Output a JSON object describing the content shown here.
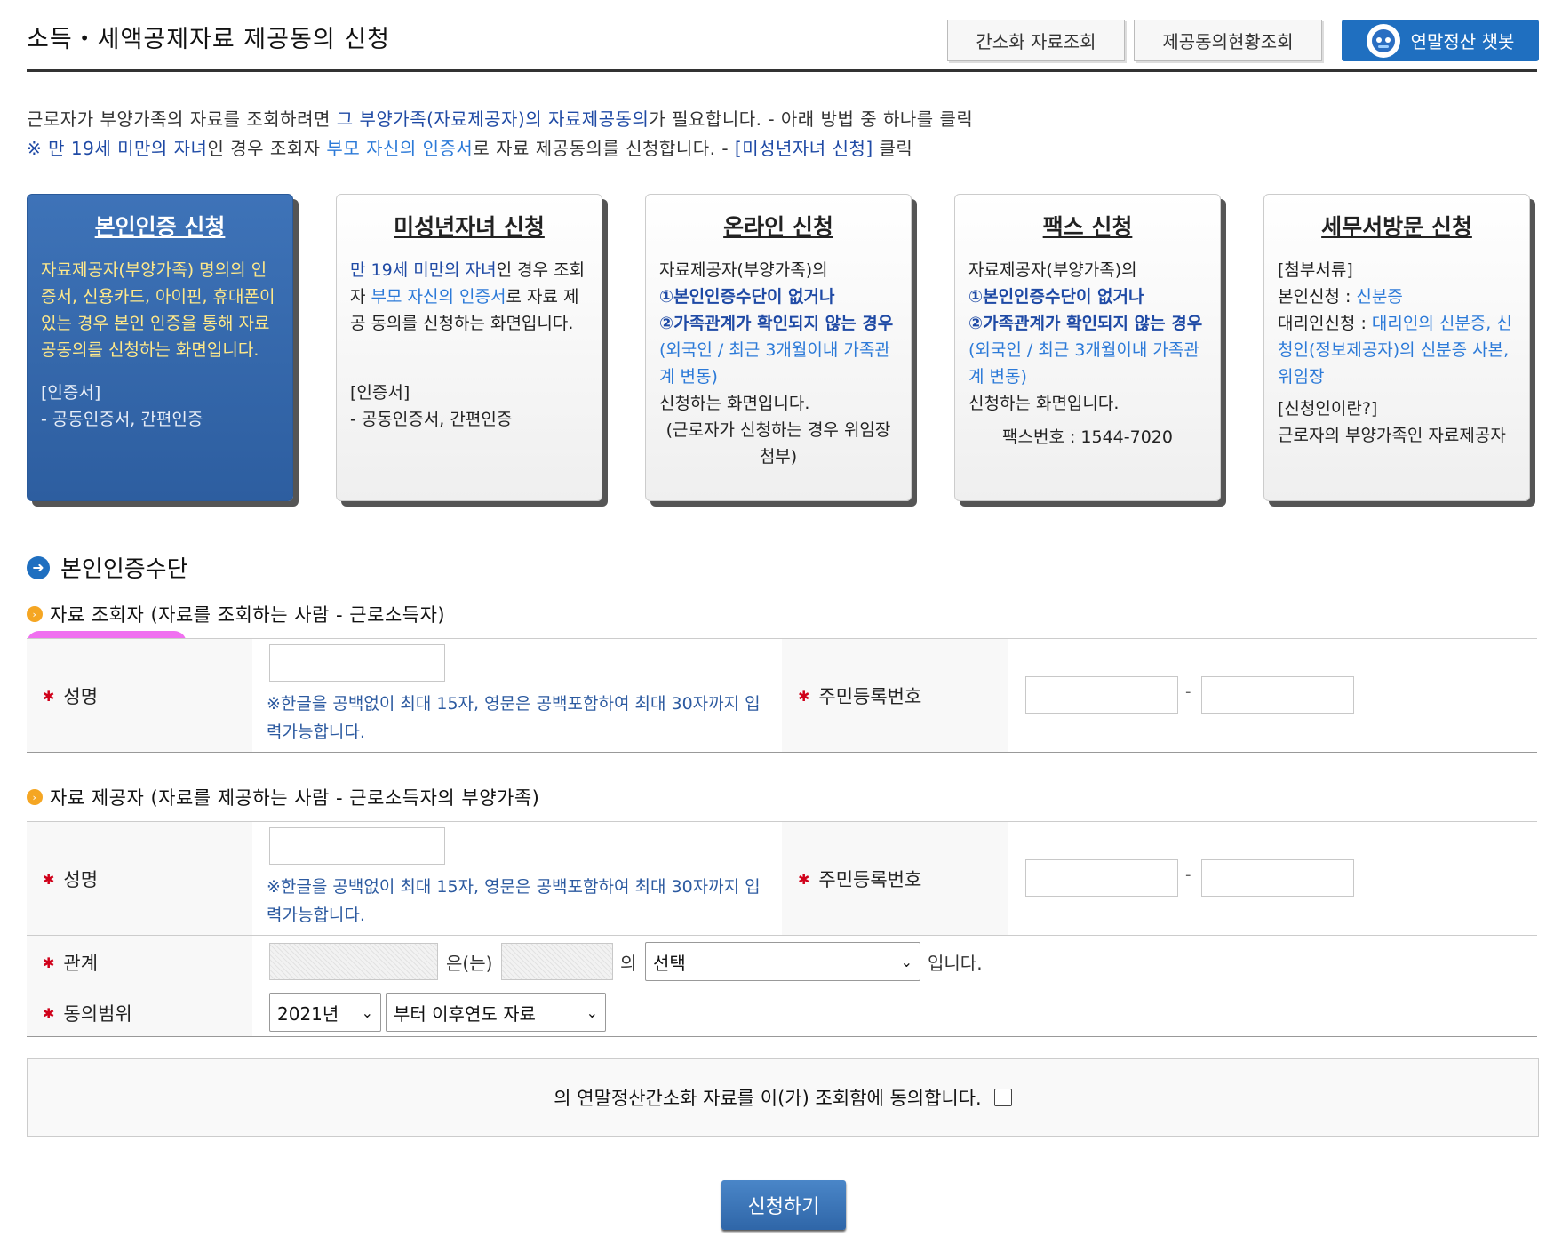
{
  "page": {
    "title": "소득・세액공제자료 제공동의 신청"
  },
  "header_buttons": {
    "simplified_lookup": "간소화 자료조회",
    "consent_status": "제공동의현황조회",
    "chatbot": "연말정산 챗봇"
  },
  "intro": {
    "line1_a": "근로자가 부양가족의 자료를 조회하려면 ",
    "line1_b": "그 부양가족(자료제공자)의 자료제공동의",
    "line1_c": "가 필요합니다. - 아래 방법 중 하나를 클릭",
    "line2_a": "※ 만 19세 미만의 자녀",
    "line2_b": "인 경우 조회자 ",
    "line2_c": "부모 자신의 인증서",
    "line2_d": "로 자료 제공동의를 신청합니다. - ",
    "line2_e": "[미성년자녀 신청]",
    "line2_f": " 클릭"
  },
  "cards": {
    "self": {
      "title": "본인인증 신청",
      "desc": "자료제공자(부양가족) 명의의 인증서, 신용카드, 아이핀, 휴대폰이 있는 경우 본인 인증을 통해 자료공동의를 신청하는 화면입니다.",
      "cert_label": "[인증서]",
      "cert_types": "- 공동인증서, 간편인증"
    },
    "minor": {
      "title": "미성년자녀 신청",
      "desc_a": "만 19세 미만의 자녀",
      "desc_b": "인 경우 조회자 ",
      "desc_c": "부모 자신의 인증서",
      "desc_d": "로 자료 제공 동의를 신청하는 화면입니다.",
      "cert_label": "[인증서]",
      "cert_types": "- 공동인증서, 간편인증"
    },
    "online": {
      "title": "온라인 신청",
      "desc_a": "자료제공자(부양가족)의",
      "desc_b": "①본인인증수단이 없거나",
      "desc_c": "②가족관계가 확인되지 않는 경우",
      "desc_d": "(외국인 / 최근 3개월이내 가족관계 변동)",
      "desc_e": "신청하는 화면입니다.",
      "desc_f": "(근로자가 신청하는 경우 위임장 첨부)"
    },
    "fax": {
      "title": "팩스 신청",
      "desc_a": "자료제공자(부양가족)의",
      "desc_b": "①본인인증수단이 없거나",
      "desc_c": "②가족관계가 확인되지 않는 경우",
      "desc_d": "(외국인 / 최근 3개월이내 가족관계 변동)",
      "desc_e": "신청하는 화면입니다.",
      "fax_no": "팩스번호 : 1544-7020"
    },
    "visit": {
      "title": "세무서방문 신청",
      "docs_label": "[첨부서류]",
      "self_a": "본인신청 : ",
      "self_b": "신분증",
      "proxy_a": "대리인신청 : ",
      "proxy_b": "대리인의 신분증, 신청인(정보제공자)의 신분증 사본, 위임장",
      "who_label": "[신청인이란?]",
      "who_desc": "근로자의 부양가족인 자료제공자"
    }
  },
  "auth_section": {
    "title": "본인인증수단"
  },
  "viewer": {
    "subtitle": "자료 조회자 (자료를 조회하는 사람 - 근로소득자)",
    "name_label": "성명",
    "name_note": "※한글을 공백없이 최대 15자, 영문은 공백포함하여 최대 30자까지 입력가능합니다.",
    "rrn_label": "주민등록번호",
    "rrn_sep": "-"
  },
  "provider": {
    "subtitle": "자료 제공자 (자료를 제공하는 사람 - 근로소득자의 부양가족)",
    "name_label": "성명",
    "name_note": "※한글을 공백없이 최대 15자, 영문은 공백포함하여 최대 30자까지 입력가능합니다.",
    "rrn_label": "주민등록번호",
    "rrn_sep": "-",
    "relation_label": "관계",
    "relation_mid1": "은(는)",
    "relation_mid2": "의",
    "relation_select": "선택",
    "relation_end": "입니다.",
    "scope_label": "동의범위",
    "scope_year": "2021년",
    "scope_range": "부터 이후연도 자료"
  },
  "agreement": {
    "text": "의 연말정산간소화 자료를 이(가) 조회함에 동의합니다."
  },
  "submit": {
    "label": "신청하기"
  },
  "colors": {
    "accent": "#1f6fc0",
    "active_card": "#3567aa",
    "link_blue": "#1f4aa5",
    "redaction": "#f070f0"
  }
}
